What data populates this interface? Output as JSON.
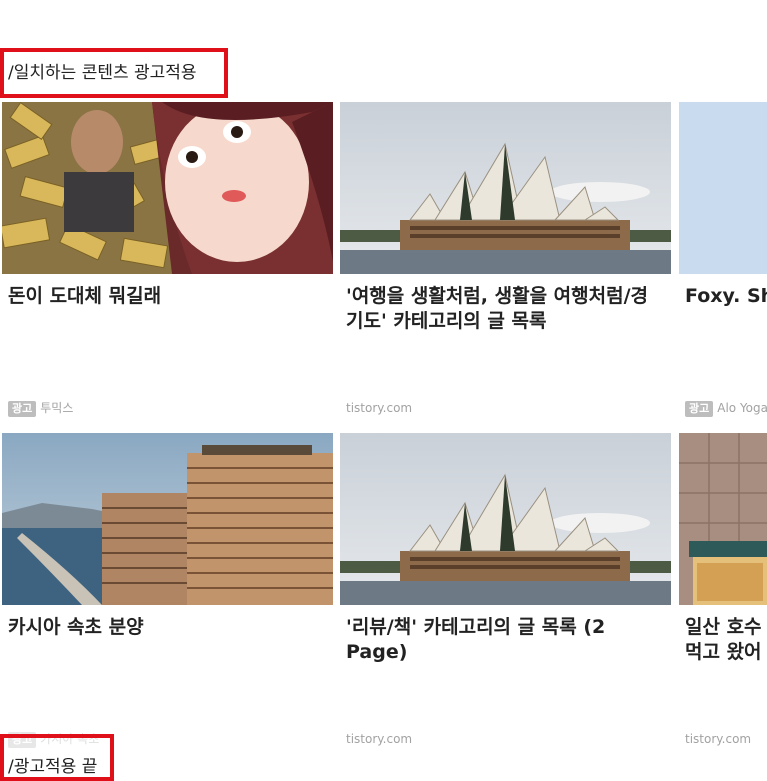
{
  "markers": {
    "start_label": "/일치하는 콘텐츠 광고적용",
    "end_label": "/광고적용 끝"
  },
  "cards": [
    {
      "title": "돈이 도대체 뭐길래",
      "ad_badge": "광고",
      "source": "투믹스"
    },
    {
      "title": "'여행을 생활처럼, 생활을 여행처럼/경기도' 카테고리의 글 목록",
      "ad_badge": "",
      "source": "tistory.com"
    },
    {
      "title": "Foxy. She",
      "ad_badge": "광고",
      "source": "Alo Yoga"
    },
    {
      "title": "카시아 속초 분양",
      "ad_badge": "광고",
      "source": "카시아 속초"
    },
    {
      "title": "'리뷰/책' 카테고리의 글 목록 (2 Page)",
      "ad_badge": "",
      "source": "tistory.com"
    },
    {
      "title": "일산 호수 먹고 왔어",
      "ad_badge": "",
      "source": "tistory.com"
    }
  ],
  "thumbnail_icons": [
    "webtoon-illustration",
    "opera-house-photo",
    "sky-photo",
    "resort-building-photo",
    "opera-house-photo",
    "storefront-photo"
  ]
}
